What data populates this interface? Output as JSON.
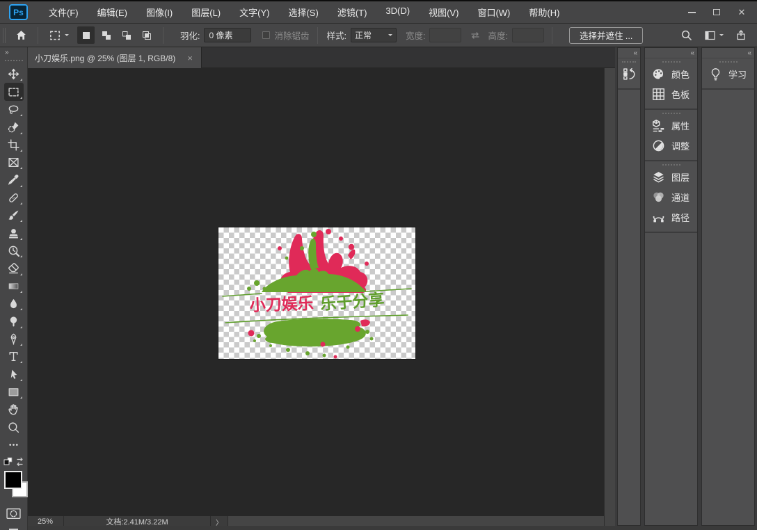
{
  "menubar": {
    "logo_text": "Ps",
    "items": [
      "文件(F)",
      "编辑(E)",
      "图像(I)",
      "图层(L)",
      "文字(Y)",
      "选择(S)",
      "滤镜(T)",
      "3D(D)",
      "视图(V)",
      "窗口(W)",
      "帮助(H)"
    ]
  },
  "window_controls": {
    "minimize": "minimize",
    "maximize": "maximize",
    "close_glyph": "✕"
  },
  "options": {
    "feather_label": "羽化:",
    "feather_value": "0 像素",
    "antialias_label": "消除锯齿",
    "style_label": "样式:",
    "style_value": "正常",
    "width_label": "宽度:",
    "width_value": "",
    "height_label": "高度:",
    "height_value": "",
    "select_and_mask": "选择并遮住 ..."
  },
  "tab": {
    "title": "小刀娱乐.png @ 25% (图层 1, RGB/8)",
    "close_glyph": "×"
  },
  "toolbar": {
    "tools": [
      "move-tool",
      "rectangular-marquee-tool",
      "lasso-tool",
      "quick-selection-tool",
      "crop-tool",
      "frame-tool",
      "eyedropper-tool",
      "spot-healing-tool",
      "brush-tool",
      "clone-stamp-tool",
      "history-brush-tool",
      "eraser-tool",
      "gradient-tool",
      "blur-tool",
      "dodge-tool",
      "pen-tool",
      "type-tool",
      "path-selection-tool",
      "rectangle-tool",
      "hand-tool",
      "zoom-tool",
      "edit-toolbar"
    ],
    "active_tool": "rectangular-marquee-tool"
  },
  "panels": {
    "column2": [
      {
        "label": "颜色"
      },
      {
        "label": "色板"
      },
      {
        "label": "属性"
      },
      {
        "label": "调整"
      },
      {
        "label": "图层"
      },
      {
        "label": "通道"
      },
      {
        "label": "路径"
      }
    ],
    "learn": {
      "label": "学习"
    }
  },
  "statusbar": {
    "zoom": "25%",
    "doc": "文档:2.41M/3.22M",
    "expander": "〉"
  },
  "canvas": {
    "title_pink": "小刀娱乐",
    "title_green": "乐于分享"
  },
  "icons": {
    "collapse_double_left": "«",
    "collapse_double_right": "»"
  },
  "colors": {
    "splash_pink": "#e02a58",
    "splash_green": "#68a52e",
    "ps_logo_blue": "#2ea3f2",
    "foreground_swatch": "#000000",
    "background_swatch": "#ffffff",
    "pasteboard": "#272727"
  }
}
